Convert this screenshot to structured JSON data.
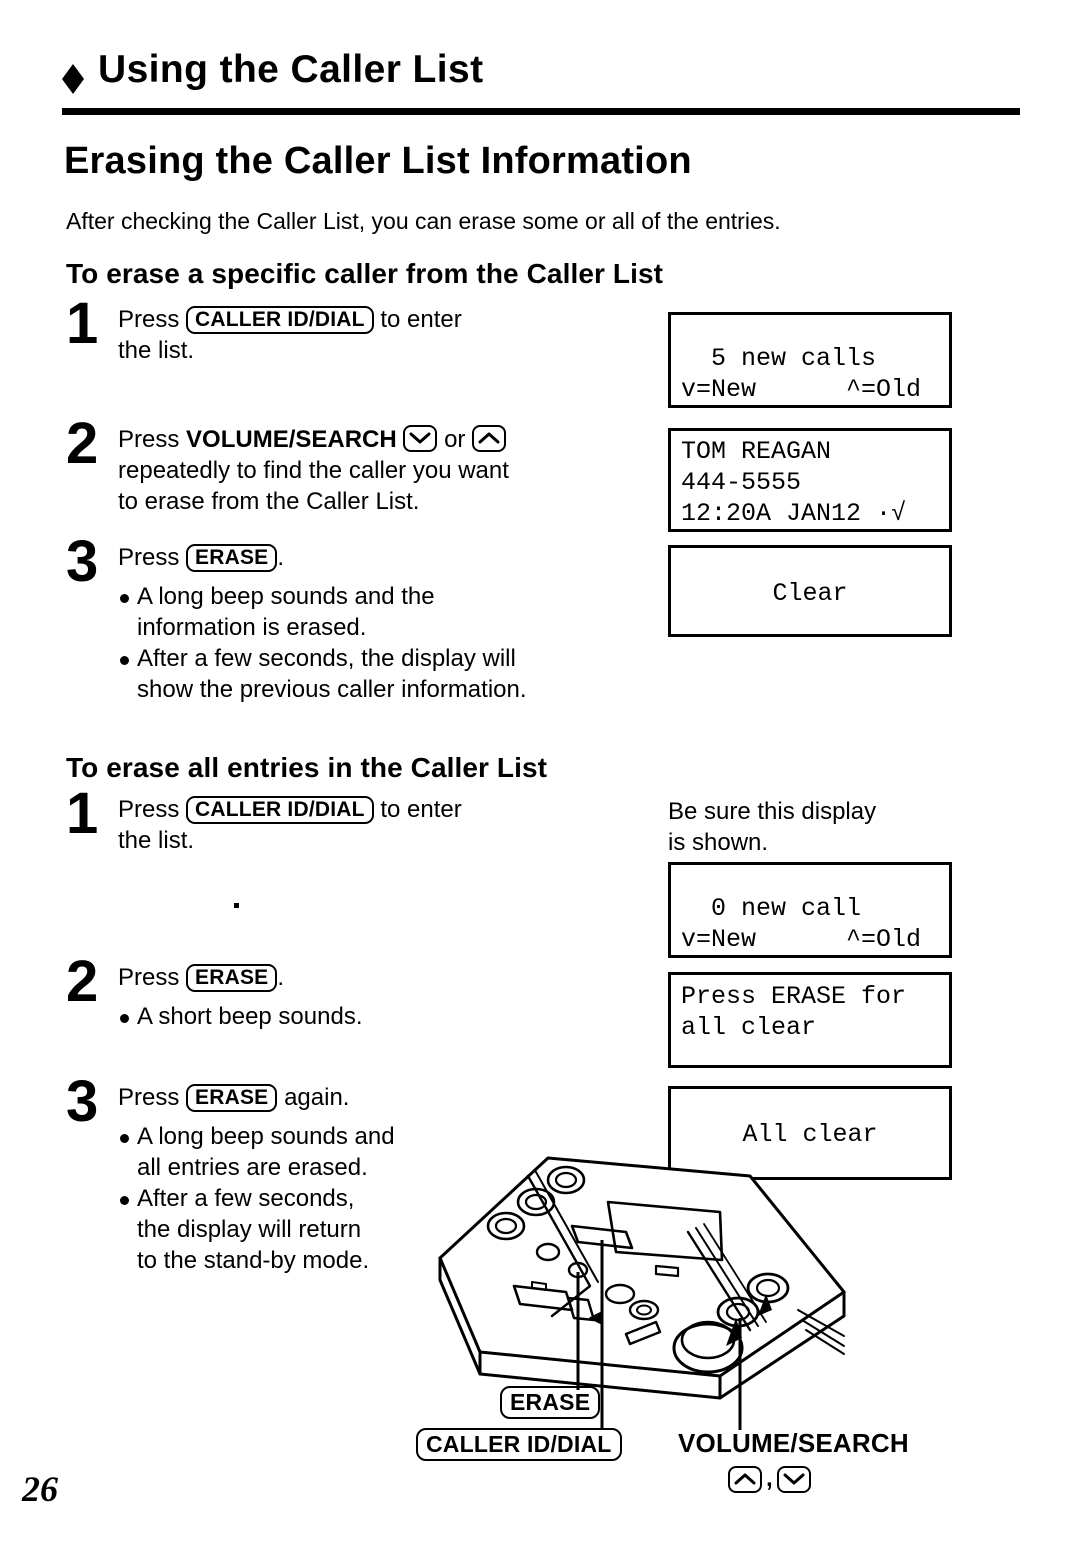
{
  "header": {
    "section_title": "Using the Caller List",
    "chapter_title": "Erasing the Caller List Information",
    "intro": "After checking the Caller List, you can erase some or all of the entries."
  },
  "section_one": {
    "heading": "To erase a specific caller from the Caller List",
    "steps": [
      {
        "number": "1",
        "press_label": "Press",
        "key": "CALLER ID/DIAL",
        "after_key": "to enter",
        "line2": "the list."
      },
      {
        "number": "2",
        "press_label": "Press",
        "key_bold": "VOLUME/SEARCH",
        "key_down_icon": "chevron-down-icon",
        "or_label": "or",
        "key_up_icon": "chevron-up-icon",
        "line2": "repeatedly to find the caller you want",
        "line3": "to erase from the Caller List."
      },
      {
        "number": "3",
        "press_label": "Press",
        "key": "ERASE",
        "after_key": ".",
        "bullets": [
          [
            "A long beep sounds and the",
            "information is erased."
          ],
          [
            "After a few seconds, the display will",
            "show the previous caller information."
          ]
        ]
      }
    ],
    "displays": [
      {
        "name": "new-calls-display",
        "rows": [
          {
            "text": "  5 new calls",
            "align": "left"
          },
          {
            "text": "v=New      ^=Old",
            "align": "left"
          }
        ]
      },
      {
        "name": "caller-info-display",
        "rows": [
          {
            "text": "TOM REAGAN",
            "align": "left"
          },
          {
            "text": "444-5555",
            "align": "left"
          },
          {
            "text": "12:20A JAN12 ·√",
            "align": "left"
          }
        ]
      },
      {
        "name": "clear-display",
        "rows": [
          {
            "text": "Clear",
            "align": "center"
          }
        ]
      }
    ]
  },
  "section_two": {
    "heading": "To erase all entries in the Caller List",
    "note": [
      "Be sure this display",
      "is shown."
    ],
    "steps": [
      {
        "number": "1",
        "press_label": "Press",
        "key": "CALLER ID/DIAL",
        "after_key": "to enter",
        "line2": "the list."
      },
      {
        "number": "2",
        "press_label": "Press",
        "key": "ERASE",
        "after_key": ".",
        "bullets": [
          [
            "A short beep sounds."
          ]
        ]
      },
      {
        "number": "3",
        "press_label": "Press",
        "key": "ERASE",
        "after_key": "again.",
        "bullets": [
          [
            "A long beep sounds and",
            "all entries are erased."
          ],
          [
            "After a few seconds,",
            "the display will return",
            "to the stand-by mode."
          ]
        ]
      }
    ],
    "displays": [
      {
        "name": "zero-new-call-display",
        "rows": [
          {
            "text": "  0 new call",
            "align": "left"
          },
          {
            "text": "v=New      ^=Old",
            "align": "left"
          }
        ]
      },
      {
        "name": "press-erase-display",
        "rows": [
          {
            "text": "Press ERASE for",
            "align": "left"
          },
          {
            "text": "all clear",
            "align": "left"
          }
        ]
      },
      {
        "name": "all-clear-display",
        "rows": [
          {
            "text": "All clear",
            "align": "center"
          }
        ]
      }
    ]
  },
  "illustration": {
    "callouts": {
      "erase": "ERASE",
      "caller_id_dial": "CALLER ID/DIAL",
      "volume_search": "VOLUME/SEARCH",
      "volume_search_keys_separator": ",",
      "up_icon": "chevron-up-icon",
      "down_icon": "chevron-down-icon"
    }
  },
  "page_number": "26",
  "colors": {
    "ink": "#000000",
    "paper": "#ffffff"
  }
}
